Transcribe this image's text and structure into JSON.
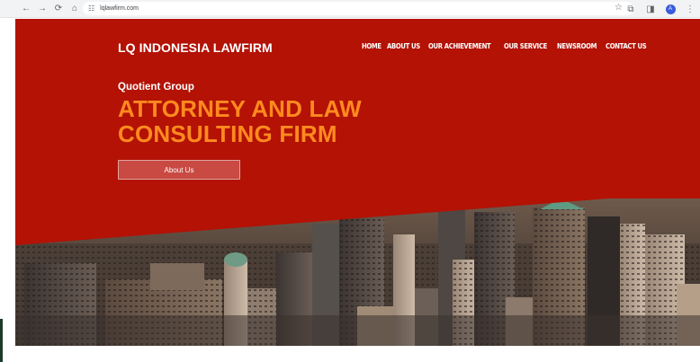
{
  "browser": {
    "url": "lqlawfirm.com",
    "avatar_letter": "A",
    "icons": [
      "back-icon",
      "forward-icon",
      "reload-icon",
      "home-icon",
      "site-settings-icon",
      "star-icon",
      "extensions-icon",
      "side-panel-icon",
      "menu-dots-icon"
    ]
  },
  "site": {
    "brand": "LQ INDONESIA LAWFIRM",
    "nav": [
      "HOME",
      "ABOUT US",
      "OUR ACHIEVEMENT",
      "OUR SERVICE",
      "NEWSROOM",
      "CONTACT US"
    ],
    "eyebrow": "Quotient Group",
    "headline_line1": "ATTORNEY AND LAW",
    "headline_line2": "CONSULTING FIRM",
    "cta_label": "About Us"
  },
  "colors": {
    "hero_red": "#b31205",
    "headline_orange": "#ff8a1f",
    "chrome_bg": "#f1f3f4"
  }
}
